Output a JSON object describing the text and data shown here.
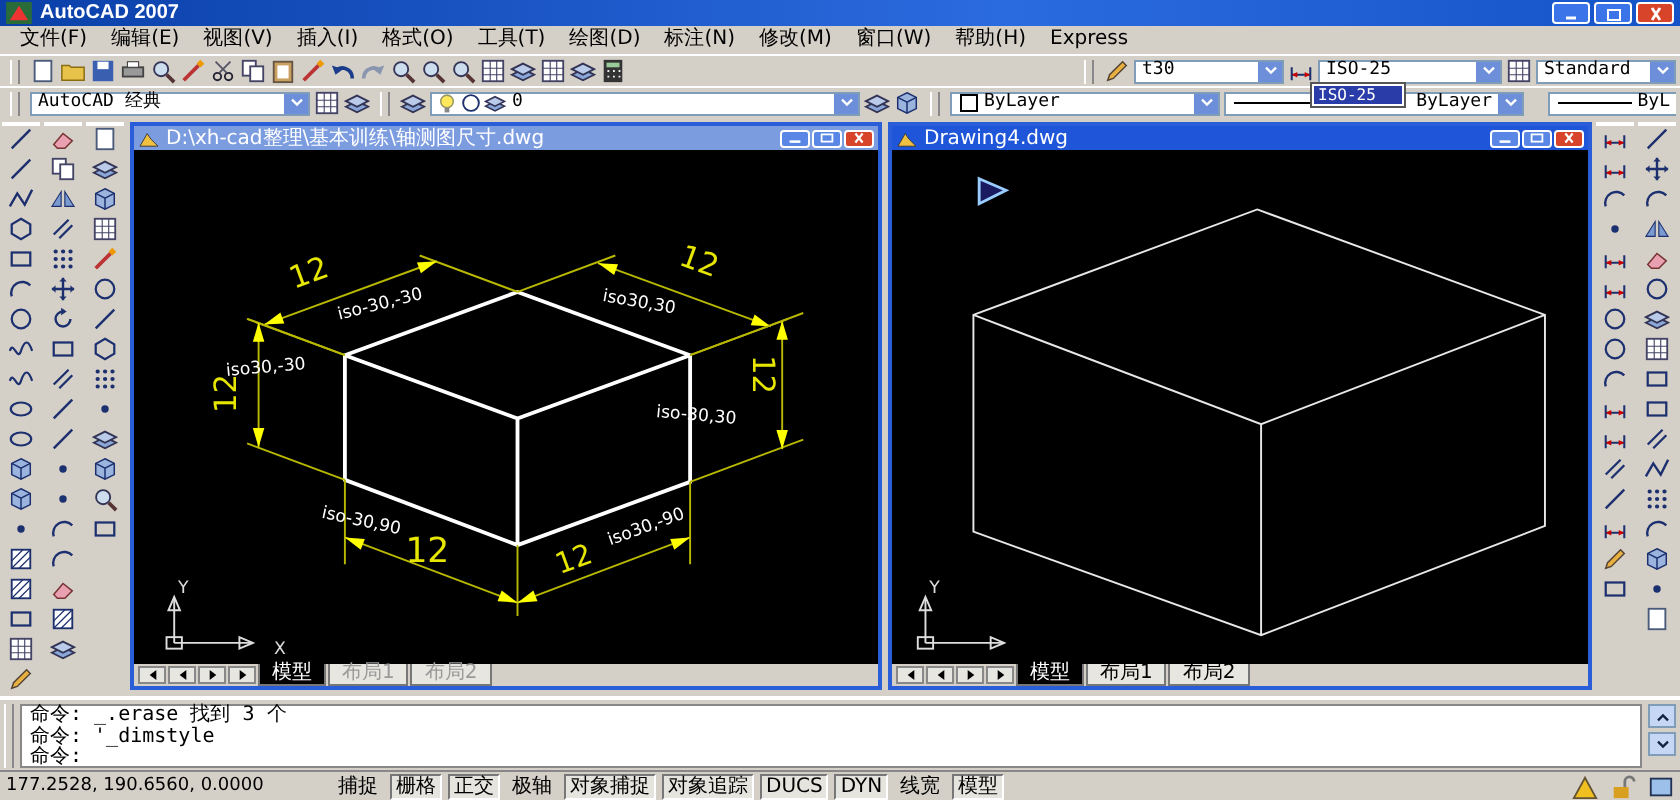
{
  "window": {
    "title": "AutoCAD 2007"
  },
  "menu": [
    "文件(F)",
    "编辑(E)",
    "视图(V)",
    "插入(I)",
    "格式(O)",
    "工具(T)",
    "绘图(D)",
    "标注(N)",
    "修改(M)",
    "窗口(W)",
    "帮助(H)",
    "Express"
  ],
  "toolbar_1": {
    "text_style": "t30",
    "dim_style": {
      "value": "ISO-25",
      "expanded": true,
      "options": [
        {
          "label": "ISO-25",
          "selected": true
        }
      ]
    },
    "table_style": "Standard"
  },
  "toolbar_2": {
    "workspace": "AutoCAD 经典",
    "layer": "0",
    "color_control": "ByLayer",
    "linetype": "ByLayer",
    "lineweight": "ByL"
  },
  "drawings": [
    {
      "title": "D:\\xh-cad整理\\基本训练\\轴测图尺寸.dwg",
      "active": false,
      "kind": "dimensioned",
      "labels": [
        {
          "text": "12",
          "kind": "value"
        },
        {
          "text": "iso-30,-30",
          "kind": "note"
        },
        {
          "text": "12",
          "kind": "value"
        },
        {
          "text": "iso30,30",
          "kind": "note"
        },
        {
          "text": "12",
          "kind": "value"
        },
        {
          "text": "iso30,-30",
          "kind": "note"
        },
        {
          "text": "12",
          "kind": "value"
        },
        {
          "text": "iso-30,30",
          "kind": "note"
        },
        {
          "text": "iso-30,90",
          "kind": "note"
        },
        {
          "text": "12",
          "kind": "value"
        },
        {
          "text": "iso30,-90",
          "kind": "note"
        },
        {
          "text": "12",
          "kind": "value"
        }
      ],
      "axes": [
        "Y",
        "X"
      ],
      "tabs": [
        {
          "label": "模型",
          "selected": true
        },
        {
          "label": "布局1",
          "selected": false
        },
        {
          "label": "布局2",
          "selected": false
        }
      ]
    },
    {
      "title": "Drawing4.dwg",
      "active": true,
      "kind": "wireframe",
      "axes": [
        "Y"
      ],
      "tabs": [
        {
          "label": "模型",
          "selected": true
        },
        {
          "label": "布局1",
          "selected": false
        },
        {
          "label": "布局2",
          "selected": false
        }
      ]
    }
  ],
  "command_line": [
    "命令: _.erase 找到 3 个",
    "命令: '_dimstyle",
    "命令:"
  ],
  "status_bar": {
    "coordinates": "177.2528, 190.6560, 0.0000",
    "toggles": [
      {
        "label": "捕捉",
        "on": false
      },
      {
        "label": "栅格",
        "on": true
      },
      {
        "label": "正交",
        "on": true
      },
      {
        "label": "极轴",
        "on": false
      },
      {
        "label": "对象捕捉",
        "on": true
      },
      {
        "label": "对象追踪",
        "on": true
      },
      {
        "label": "DUCS",
        "on": true
      },
      {
        "label": "DYN",
        "on": true
      },
      {
        "label": "线宽",
        "on": false
      },
      {
        "label": "模型",
        "on": true
      }
    ]
  }
}
